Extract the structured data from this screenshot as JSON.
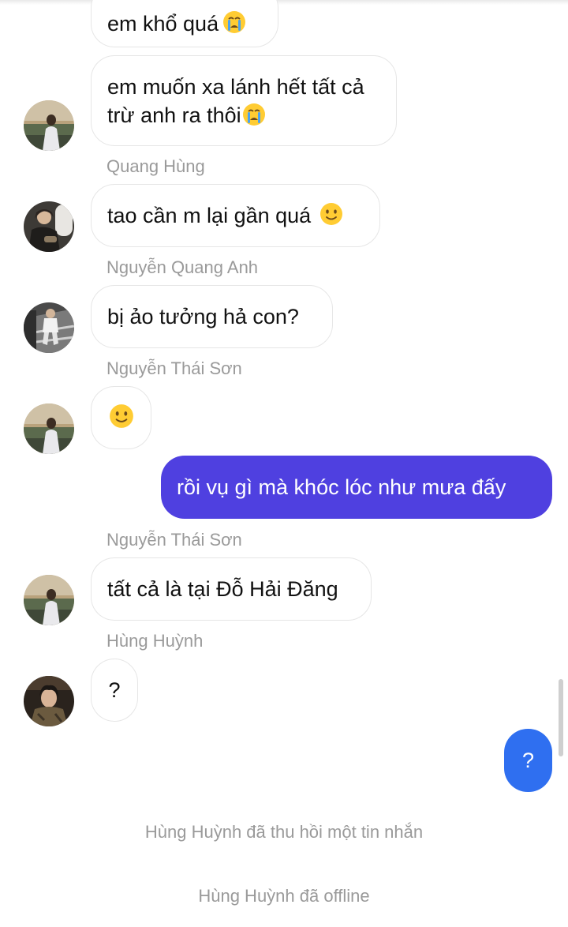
{
  "messages": [
    {
      "text": "em khổ quá"
    },
    {
      "text": "em muốn xa lánh hết tất cả trừ anh ra thôi"
    },
    {
      "sender": "Quang Hùng",
      "text": "tao cần m lại gần quá"
    },
    {
      "sender": "Nguyễn Quang Anh",
      "text": "bị ảo tưởng hả con?"
    },
    {
      "sender": "Nguyễn Thái Sơn"
    },
    {
      "text": "rồi vụ gì mà khóc lóc như mưa đấy"
    },
    {
      "sender": "Nguyễn Thái Sơn",
      "text": "tất cả là tại Đỗ Hải Đăng"
    },
    {
      "sender": "Hùng Huỳnh",
      "text": "?"
    },
    {
      "text": "?"
    }
  ],
  "system_messages": [
    "Hùng Huỳnh đã thu hồi một tin nhắn",
    "Hùng Huỳnh đã offline"
  ],
  "colors": {
    "sent_bubble": "#4f40e0",
    "sent_bubble_blue": "#2f6ff0",
    "received_bubble_border": "#e6e6e6",
    "sender_name": "#9a9a9a"
  },
  "icons": {
    "crying": "crying-face-emoji",
    "smile": "slightly-smiling-face-emoji"
  }
}
